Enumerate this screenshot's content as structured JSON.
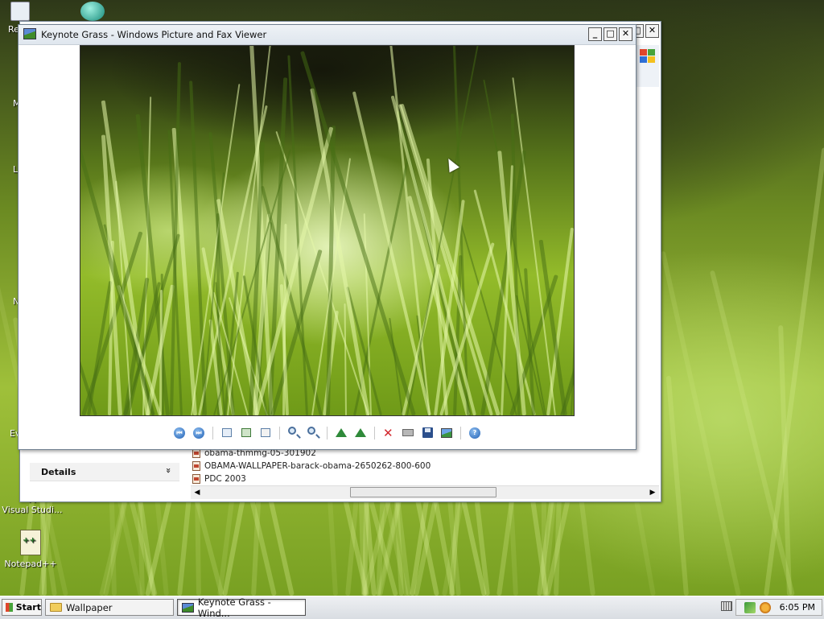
{
  "desktop": {
    "icons": [
      {
        "label": "Re"
      },
      {
        "label": "M"
      },
      {
        "label": "L"
      },
      {
        "label": "N"
      },
      {
        "label": "Ev"
      },
      {
        "label": "M\nVisual Studi..."
      },
      {
        "label": "Notepad++"
      }
    ]
  },
  "explorer": {
    "details_label": "Details",
    "details_chevron": "»",
    "files": [
      {
        "name": "obama-thmmg-05-301902"
      },
      {
        "name": "OBAMA-WALLPAPER-barack-obama-2650262-800-600"
      },
      {
        "name": "PDC 2003"
      }
    ],
    "scroll_left": "◀",
    "scroll_right": "▶"
  },
  "viewer": {
    "title": "Keynote Grass - Windows Picture and Fax Viewer",
    "minimize": "_",
    "maximize": "□",
    "close": "✕",
    "image_subject": "green-grass-photo",
    "toolbar": {
      "prev_glyph": "⏮",
      "next_glyph": "⏭",
      "delete_glyph": "✕"
    }
  },
  "taskbar": {
    "start_label": "Start",
    "tasks": [
      {
        "label": "Wallpaper",
        "icon": "folder-icon"
      },
      {
        "label": "Keynote Grass - Wind...",
        "icon": "image-viewer-icon"
      }
    ],
    "clock": "6:05 PM"
  },
  "colors": {
    "delete_red": "#d2272d",
    "rotate_green": "#2f8a3a",
    "nav_blue": "#1f5fb4"
  }
}
